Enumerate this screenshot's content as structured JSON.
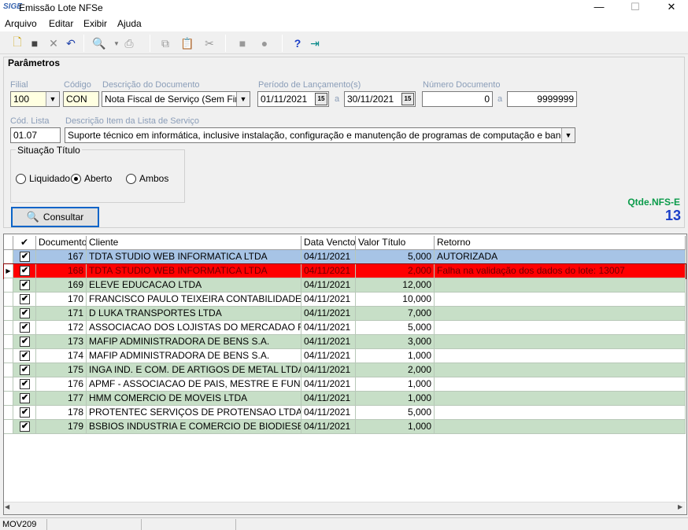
{
  "window": {
    "logo": "SIGE",
    "title": "Emissão Lote NFSe",
    "minimize": "—",
    "maximize": "☐",
    "close": "✕"
  },
  "menu": [
    "Arquivo",
    "Editar",
    "Exibir",
    "Ajuda"
  ],
  "toolbar": {
    "icons": [
      "new-icon",
      "save-icon",
      "delete-icon",
      "undo-icon",
      "preview-icon",
      "print-icon",
      "copy-icon",
      "paste-icon",
      "cut-icon",
      "first-icon",
      "last-icon",
      "help-icon",
      "exit-icon"
    ]
  },
  "params": {
    "title": "Parâmetros",
    "filial": {
      "label": "Filial",
      "value": "100"
    },
    "codigo": {
      "label": "Código",
      "value": "CON"
    },
    "descricao": {
      "label": "Descrição do Documento",
      "value": "Nota Fiscal de Serviço (Sem Financeiro)"
    },
    "periodo": {
      "label": "Período de Lançamento(s)",
      "from": "01/11/2021",
      "sep": "a",
      "to": "30/11/2021"
    },
    "numero": {
      "label": "Número Documento",
      "from": "0",
      "sep": "a",
      "to": "9999999"
    },
    "cod_lista": {
      "label": "Cód. Lista",
      "value": "01.07"
    },
    "desc_item": {
      "label": "Descrição Item da Lista de Serviço",
      "value": "Suporte técnico em informática, inclusive instalação, configuração e manutenção de programas de computação e bancos de dados."
    },
    "situacao": {
      "title": "Situação Título",
      "options": [
        "Liquidado",
        "Aberto",
        "Ambos"
      ],
      "selected": "Aberto"
    },
    "consultar_label": "Consultar",
    "qtde_label": "Qtde.NFS-E",
    "qtde_value": "13"
  },
  "grid": {
    "headers": [
      "✔",
      "Documento",
      "Cliente",
      "Data Vencto.",
      "Valor Título",
      "Retorno"
    ],
    "rows": [
      {
        "doc": "167",
        "cliente": "TDTA STUDIO WEB INFORMATICA LTDA",
        "data": "04/11/2021",
        "valor": "5,000",
        "retorno": "AUTORIZADA",
        "style": "blue"
      },
      {
        "doc": "168",
        "cliente": "TDTA STUDIO WEB INFORMATICA LTDA",
        "data": "04/11/2021",
        "valor": "2,000",
        "retorno": "Falha na validação dos dados do lote: 13007",
        "style": "red"
      },
      {
        "doc": "169",
        "cliente": "ELEVE EDUCACAO LTDA",
        "data": "04/11/2021",
        "valor": "12,000",
        "retorno": "",
        "style": "green"
      },
      {
        "doc": "170",
        "cliente": "FRANCISCO PAULO TEIXEIRA CONTABILIDADE",
        "data": "04/11/2021",
        "valor": "10,000",
        "retorno": "",
        "style": "white"
      },
      {
        "doc": "171",
        "cliente": "D LUKA TRANSPORTES LTDA",
        "data": "04/11/2021",
        "valor": "7,000",
        "retorno": "",
        "style": "green"
      },
      {
        "doc": "172",
        "cliente": "ASSOCIACAO DOS LOJISTAS DO MERCADAO FRATERNAL",
        "data": "04/11/2021",
        "valor": "5,000",
        "retorno": "",
        "style": "white"
      },
      {
        "doc": "173",
        "cliente": "MAFIP ADMINISTRADORA DE BENS S.A.",
        "data": "04/11/2021",
        "valor": "3,000",
        "retorno": "",
        "style": "green"
      },
      {
        "doc": "174",
        "cliente": "MAFIP ADMINISTRADORA DE BENS S.A.",
        "data": "04/11/2021",
        "valor": "1,000",
        "retorno": "",
        "style": "white"
      },
      {
        "doc": "175",
        "cliente": "INGA IND. E COM. DE ARTIGOS DE METAL LTDA",
        "data": "04/11/2021",
        "valor": "2,000",
        "retorno": "",
        "style": "green"
      },
      {
        "doc": "176",
        "cliente": "APMF - ASSOCIACAO DE PAIS, MESTRE E FUNCIONARIOS",
        "data": "04/11/2021",
        "valor": "1,000",
        "retorno": "",
        "style": "white"
      },
      {
        "doc": "177",
        "cliente": "HMM COMERCIO DE MOVEIS LTDA",
        "data": "04/11/2021",
        "valor": "1,000",
        "retorno": "",
        "style": "green"
      },
      {
        "doc": "178",
        "cliente": "PROTENTEC SERVIÇOS DE PROTENSAO LTDA",
        "data": "04/11/2021",
        "valor": "5,000",
        "retorno": "",
        "style": "white"
      },
      {
        "doc": "179",
        "cliente": "BSBIOS INDUSTRIA E COMERCIO DE BIODIESEL SUL BRASIL",
        "data": "04/11/2021",
        "valor": "1,000",
        "retorno": "",
        "style": "green"
      }
    ]
  },
  "statusbar": {
    "code": "MOV209"
  },
  "colors": {
    "row_blue": "#a7c4e6",
    "row_red": "#ff0000",
    "row_green": "#c7dfc7",
    "row_white": "#ffffff",
    "qtde_label": "#0a9b4a",
    "qtde_value": "#1a3ec8"
  }
}
